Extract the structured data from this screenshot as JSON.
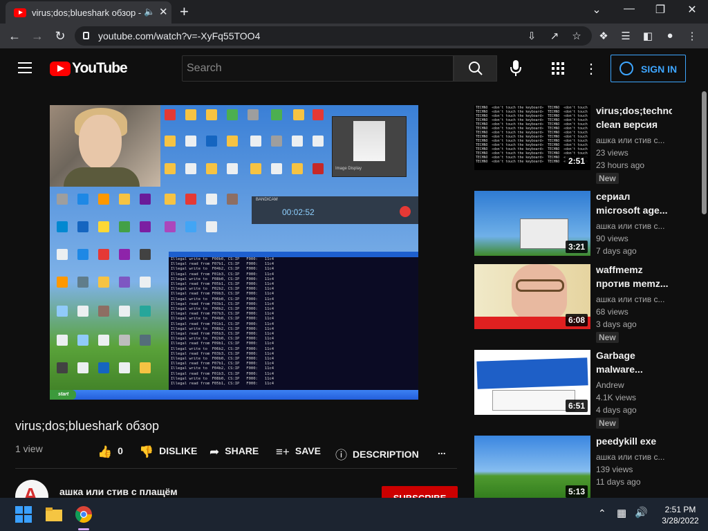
{
  "browser": {
    "tab_title": "virus;dos;blueshark обзор - YouTube",
    "url": "youtube.com/watch?v=-XyFq55TOO4"
  },
  "youtube": {
    "logo_text": "YouTube",
    "search_placeholder": "Search",
    "sign_in": "SIGN IN"
  },
  "video": {
    "recorder_brand": "BANDICAM",
    "recorder_time": "00:02:52",
    "image_window_caption": "Image Display",
    "taskbar_start": "start",
    "title": "virus;dos;blueshark обзор",
    "views": "1 view",
    "likes": "0",
    "dislike_label": "DISLIKE",
    "share_label": "SHARE",
    "save_label": "SAVE",
    "description_label": "DESCRIPTION",
    "more_label": "...",
    "channel_name": "ашка или стив с плащём",
    "subscribe_label": "SUBSCRIBE"
  },
  "recommendations": [
    {
      "title": "virus;dos;techno clean версия",
      "channel": "ашка или стив с...",
      "views": "23 views",
      "age": "23 hours ago",
      "badge": "New",
      "duration": "2:51"
    },
    {
      "title": "сериал microsoft age...",
      "channel": "ашка или стив с...",
      "views": "90 views",
      "age": "7 days ago",
      "badge": "",
      "duration": "3:21"
    },
    {
      "title": "waffmemz против memz...",
      "channel": "ашка или стив с...",
      "views": "68 views",
      "age": "3 days ago",
      "badge": "New",
      "duration": "6:08"
    },
    {
      "title": "Garbage malware...",
      "channel": "Andrew",
      "views": "4.1K views",
      "age": "4 days ago",
      "badge": "New",
      "duration": "6:51"
    },
    {
      "title": "peedykill exe",
      "channel": "ашка или стив с...",
      "views": "139 views",
      "age": "11 days ago",
      "badge": "",
      "duration": "5:13"
    }
  ],
  "taskbar": {
    "time": "2:51 PM",
    "date": "3/28/2022"
  },
  "colors": {
    "youtube_red": "#ff0000",
    "sign_in_blue": "#3ea6ff",
    "subscribe_red": "#cc0000"
  }
}
